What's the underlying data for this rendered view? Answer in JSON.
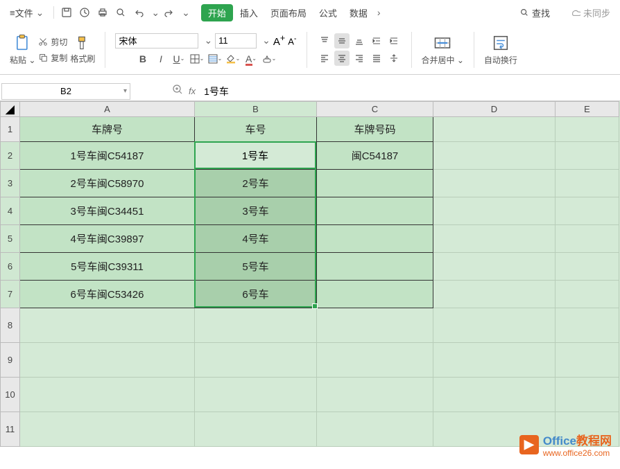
{
  "menu": {
    "file": "文件",
    "tabs": [
      "开始",
      "插入",
      "页面布局",
      "公式",
      "数据"
    ],
    "search": "查找",
    "sync": "未同步"
  },
  "ribbon": {
    "paste": "粘贴",
    "cut": "剪切",
    "copy": "复制",
    "brush": "格式刷",
    "font_name": "宋体",
    "font_size": "11",
    "merge": "合并居中",
    "wrap": "自动换行"
  },
  "namebox": "B2",
  "formula_value": "1号车",
  "columns": [
    "A",
    "B",
    "C",
    "D",
    "E"
  ],
  "rows": [
    "1",
    "2",
    "3",
    "4",
    "5",
    "6",
    "7",
    "8",
    "9",
    "10",
    "11"
  ],
  "headers": {
    "A": "车牌号",
    "B": "车号",
    "C": "车牌号码"
  },
  "data": [
    {
      "A": "1号车闽C54187",
      "B": "1号车",
      "C": "闽C54187"
    },
    {
      "A": "2号车闽C58970",
      "B": "2号车",
      "C": ""
    },
    {
      "A": "3号车闽C34451",
      "B": "3号车",
      "C": ""
    },
    {
      "A": "4号车闽C39897",
      "B": "4号车",
      "C": ""
    },
    {
      "A": "5号车闽C39311",
      "B": "5号车",
      "C": ""
    },
    {
      "A": "6号车闽C53426",
      "B": "6号车",
      "C": ""
    }
  ],
  "watermark": {
    "brand1": "Office",
    "brand2": "教程网",
    "url": "www.office26.com"
  }
}
